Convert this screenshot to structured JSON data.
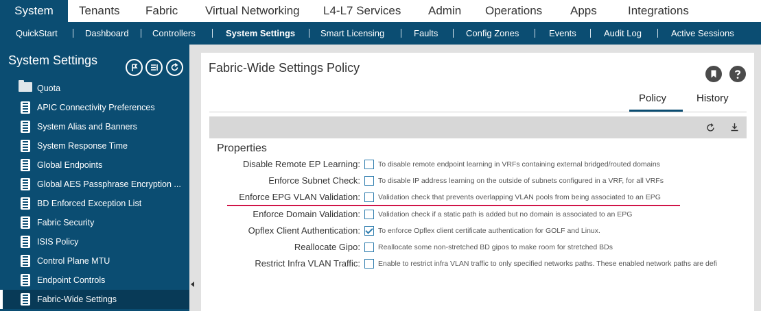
{
  "topnav": {
    "tabs": [
      {
        "label": "System",
        "active": true
      },
      {
        "label": "Tenants"
      },
      {
        "label": "Fabric"
      },
      {
        "label": "Virtual Networking"
      },
      {
        "label": "L4-L7 Services"
      },
      {
        "label": "Admin"
      },
      {
        "label": "Operations"
      },
      {
        "label": "Apps"
      },
      {
        "label": "Integrations"
      }
    ]
  },
  "subnav": {
    "items": [
      {
        "label": "QuickStart"
      },
      {
        "label": "Dashboard"
      },
      {
        "label": "Controllers"
      },
      {
        "label": "System Settings",
        "active": true
      },
      {
        "label": "Smart Licensing"
      },
      {
        "label": "Faults"
      },
      {
        "label": "Config Zones"
      },
      {
        "label": "Events"
      },
      {
        "label": "Audit Log"
      },
      {
        "label": "Active Sessions"
      }
    ]
  },
  "sidebar": {
    "title": "System Settings",
    "items": [
      {
        "label": "Quota",
        "icon": "folder-icon"
      },
      {
        "label": "APIC Connectivity Preferences",
        "icon": "policy-file-icon"
      },
      {
        "label": "System Alias and Banners",
        "icon": "policy-file-icon"
      },
      {
        "label": "System Response Time",
        "icon": "policy-file-icon"
      },
      {
        "label": "Global Endpoints",
        "icon": "policy-file-icon"
      },
      {
        "label": "Global AES Passphrase Encryption ...",
        "icon": "policy-file-icon"
      },
      {
        "label": "BD Enforced Exception List",
        "icon": "policy-file-icon"
      },
      {
        "label": "Fabric Security",
        "icon": "policy-file-icon"
      },
      {
        "label": "ISIS Policy",
        "icon": "policy-file-icon"
      },
      {
        "label": "Control Plane MTU",
        "icon": "policy-file-icon"
      },
      {
        "label": "Endpoint Controls",
        "icon": "policy-file-icon"
      },
      {
        "label": "Fabric-Wide Settings",
        "icon": "policy-file-icon",
        "selected": true
      }
    ]
  },
  "main": {
    "title": "Fabric-Wide Settings Policy",
    "tabs": [
      {
        "label": "Policy",
        "active": true
      },
      {
        "label": "History"
      }
    ],
    "section_title": "Properties",
    "properties": [
      {
        "label": "Disable Remote EP Learning:",
        "checked": false,
        "description": "To disable remote endpoint learning in VRFs containing external bridged/routed domains"
      },
      {
        "label": "Enforce Subnet Check:",
        "checked": false,
        "description": "To disable IP address learning on the outside of subnets configured in a VRF, for all VRFs"
      },
      {
        "label": "Enforce EPG VLAN Validation:",
        "checked": false,
        "description": "Validation check that prevents overlapping VLAN pools from being associated to an EPG",
        "highlighted": true
      },
      {
        "label": "Enforce Domain Validation:",
        "checked": false,
        "description": "Validation check if a static path is added but no domain is associated to an EPG"
      },
      {
        "label": "Opflex Client Authentication:",
        "checked": true,
        "description": "To enforce Opflex client certificate authentication for GOLF and Linux."
      },
      {
        "label": "Reallocate Gipo:",
        "checked": false,
        "description": "Reallocate some non-stretched BD gipos to make room for stretched BDs"
      },
      {
        "label": "Restrict Infra VLAN Traffic:",
        "checked": false,
        "description": "Enable to restrict infra VLAN traffic to only specified networks paths. These enabled network paths are defi"
      }
    ]
  },
  "colors": {
    "nav_blue": "#0b4d72",
    "highlight_red": "#d01448",
    "checkbox_blue": "#2f7dae"
  }
}
